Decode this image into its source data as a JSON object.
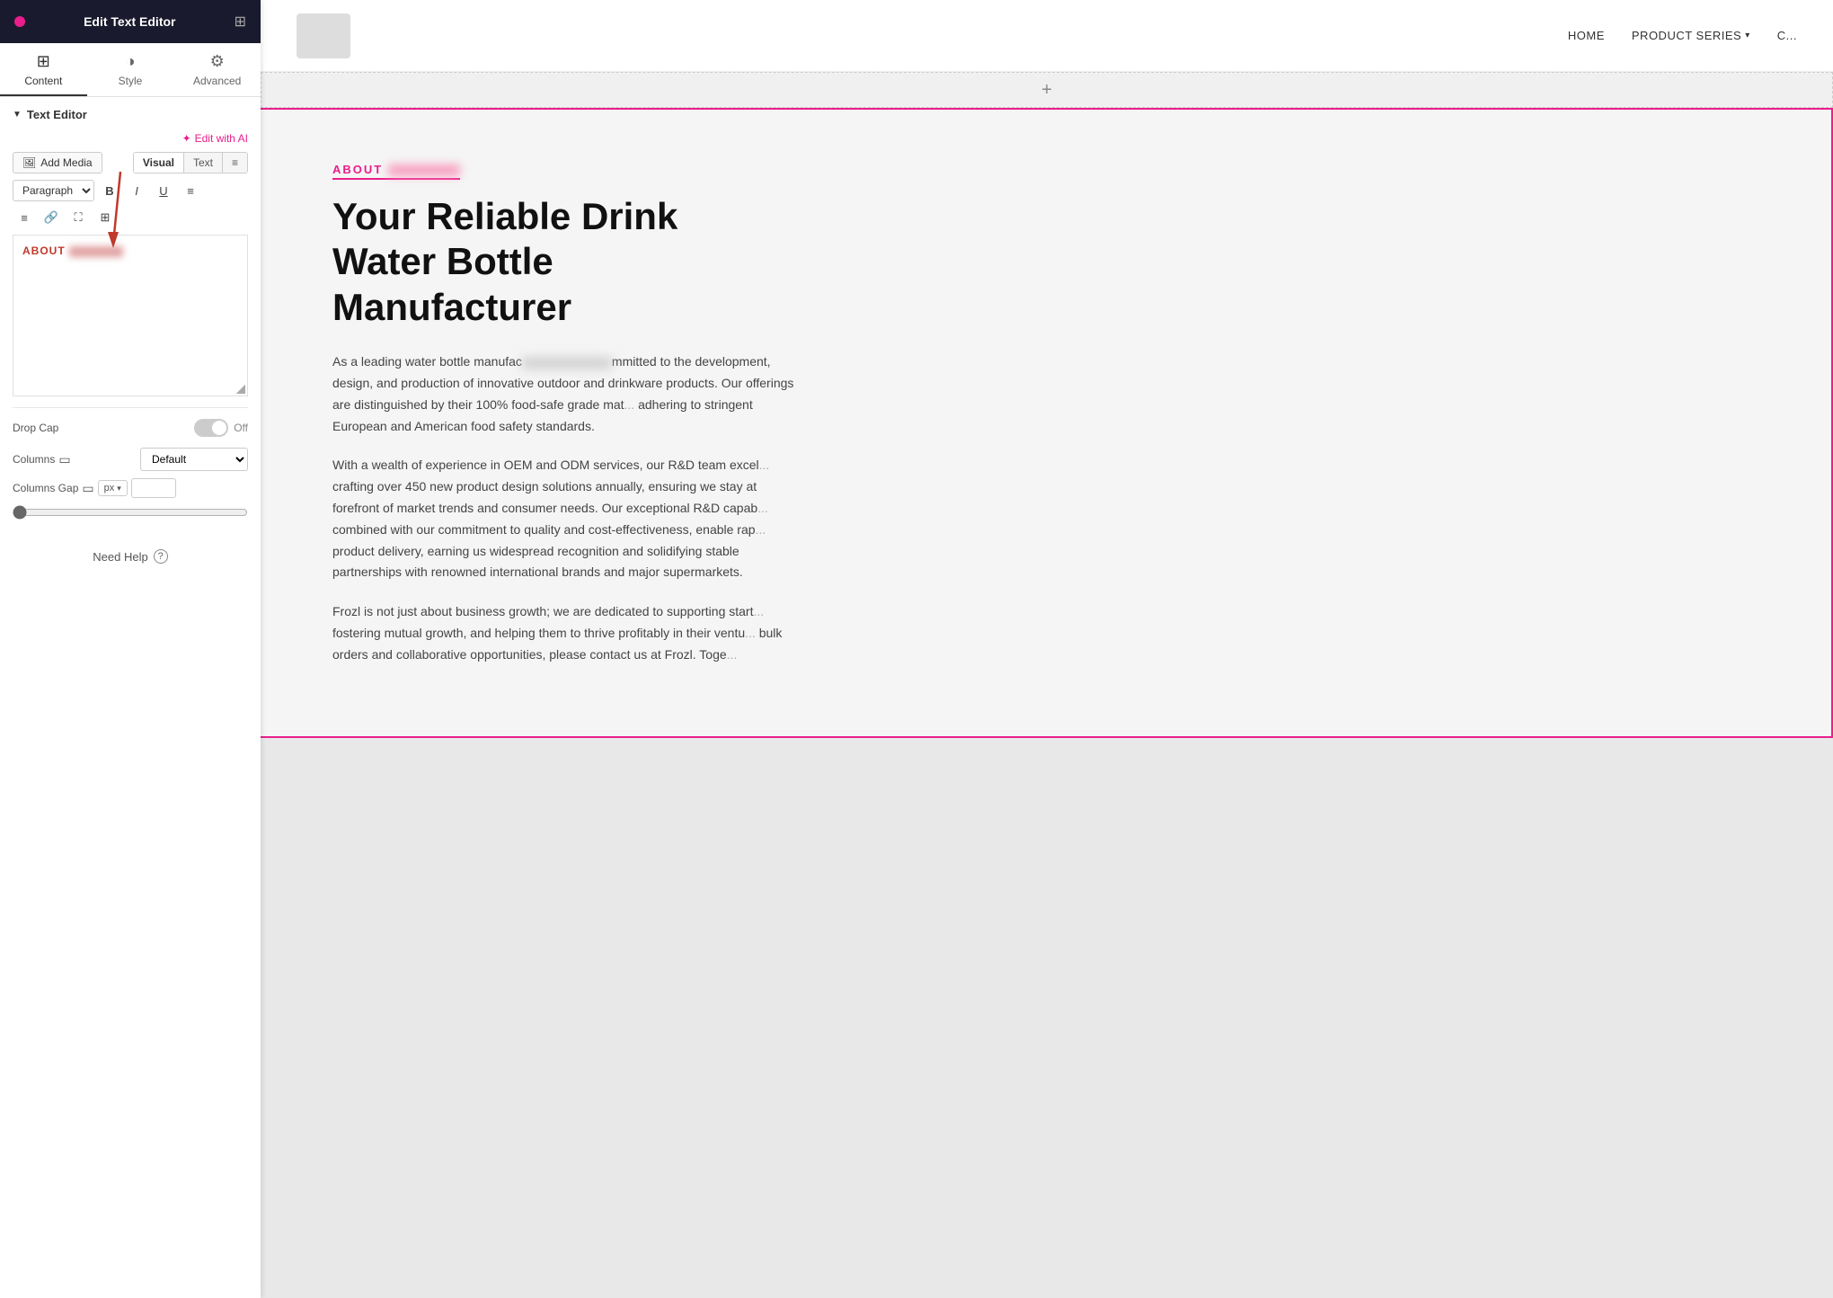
{
  "panel": {
    "header": {
      "title": "Edit Text Editor",
      "dot_color": "#e91e8c"
    },
    "tabs": [
      {
        "id": "content",
        "label": "Content",
        "icon": "⊞",
        "active": true
      },
      {
        "id": "style",
        "label": "Style",
        "icon": "◑",
        "active": false
      },
      {
        "id": "advanced",
        "label": "Advanced",
        "icon": "⚙",
        "active": false
      }
    ],
    "section_title": "Text Editor",
    "edit_ai_label": "Edit with AI",
    "add_media_label": "Add Media",
    "view_tabs": [
      {
        "label": "Visual",
        "active": true
      },
      {
        "label": "Text",
        "active": false
      }
    ],
    "format_options": [
      "Paragraph"
    ],
    "format_buttons": [
      "B",
      "I",
      "U",
      "≡"
    ],
    "format_buttons2": [
      "≡",
      "🔗",
      "✕",
      "⊞"
    ],
    "editor_content": "ABOUT [REDACTED]",
    "drop_cap_label": "Drop Cap",
    "drop_cap_value": "Off",
    "columns_label": "Columns",
    "columns_value": "Default",
    "columns_gap_label": "Columns Gap",
    "columns_gap_unit": "px",
    "need_help_label": "Need Help"
  },
  "site": {
    "nav_items": [
      {
        "label": "HOME"
      },
      {
        "label": "PRODUCT SERIES",
        "has_dropdown": true
      },
      {
        "label": "C..."
      }
    ],
    "about_label": "ABOUT [REDACTED]",
    "main_heading": "Your Reliable Drink Water Bottle Manufacturer",
    "para1": "As a leading water bottle manufacturer in China, Frozl is committed to the development, design, and production of innovative outdoor and drinkware products. Our offerings are distinguished by their 100% food-safe grade materials, adhering to stringent European and American food safety standards.",
    "para2": "With a wealth of experience in OEM and ODM services, our R&D team excels at crafting over 450 new product design solutions annually, ensuring we stay at the forefront of market trends and consumer needs. Our exceptional R&D capabilities, combined with our commitment to quality and cost-effectiveness, enable rapid product delivery, earning us widespread recognition and solidifying stable partnerships with renowned international brands and major supermarkets.",
    "para3": "Frozl is not just about business growth; we are dedicated to supporting startups, fostering mutual growth, and helping them to thrive profitably in their ventures. For bulk orders and collaborative opportunities, please contact us at Frozl. Together..."
  }
}
